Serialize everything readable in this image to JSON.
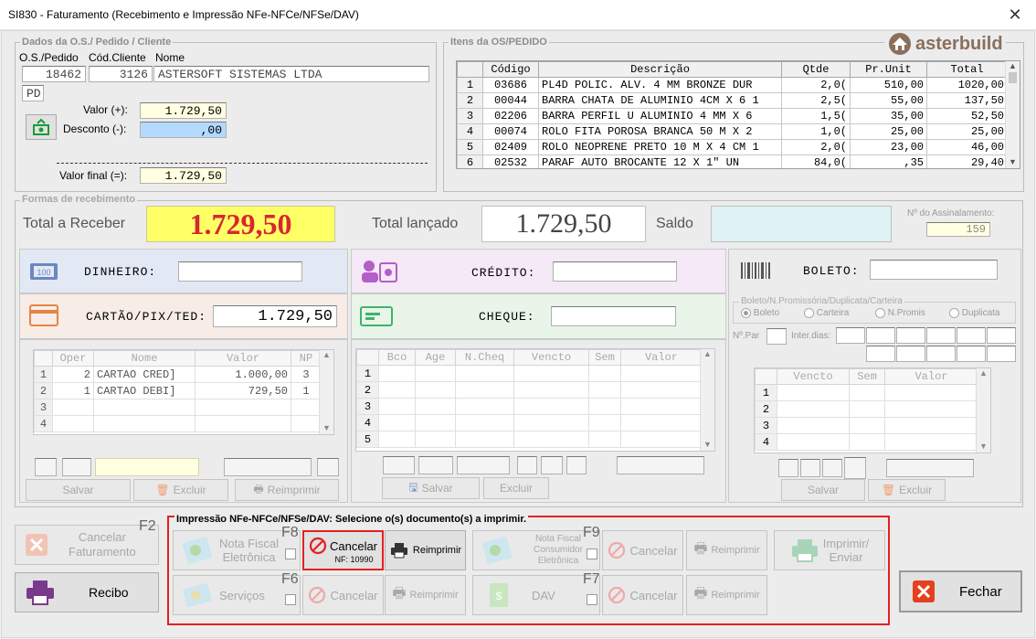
{
  "window": {
    "title": "SI830 - Faturamento (Recebimento e Impressão NFe-NFCe/NFSe/DAV)",
    "close": "✕"
  },
  "logo": {
    "text": "asterbuild"
  },
  "dados": {
    "group_label": "Dados da O.S./ Pedido / Cliente",
    "col_os": "O.S./Pedido",
    "col_cli": "Cód.Cliente",
    "col_nome": "Nome",
    "os": "18462",
    "cliente": "3126",
    "nome": "ASTERSOFT SISTEMAS LTDA",
    "tipo": "PD",
    "valor_label": "Valor (+):",
    "valor": "1.729,50",
    "desconto_label": "Desconto (-):",
    "desconto": ",00",
    "final_label": "Valor final (=):",
    "final": "1.729,50"
  },
  "itens": {
    "group_label": "Itens da OS/PEDIDO",
    "headers": [
      "",
      "Código",
      "Descrição",
      "Qtde",
      "Pr.Unit",
      "Total"
    ],
    "rows": [
      [
        "1",
        "03686",
        "PL4D POLIC. ALV. 4 MM BRONZE DUR",
        "2,0(",
        "510,00",
        "1020,00"
      ],
      [
        "2",
        "00044",
        "BARRA CHATA DE ALUMINIO 4CM X 6 1",
        "2,5(",
        "55,00",
        "137,50"
      ],
      [
        "3",
        "02206",
        "BARRA PERFIL U ALUMINIO 4 MM X 6",
        "1,5(",
        "35,00",
        "52,50"
      ],
      [
        "4",
        "00074",
        "ROLO FITA POROSA BRANCA 50 M X 2",
        "1,0(",
        "25,00",
        "25,00"
      ],
      [
        "5",
        "02409",
        "ROLO NEOPRENE PRETO 10 M X 4 CM 1",
        "2,0(",
        "23,00",
        "46,00"
      ],
      [
        "6",
        "02532",
        "PARAF AUTO BROCANTE  12 X 1\"  UN",
        "84,0(",
        ",35",
        "29,40"
      ]
    ]
  },
  "formas": {
    "group_label": "Formas de recebimento",
    "total_receber_label": "Total a Receber",
    "total_receber": "1.729,50",
    "total_lancado_label": "Total lançado",
    "total_lancado": "1.729,50",
    "saldo_label": "Saldo",
    "saldo": "",
    "assinal_label": "Nº do Assinalamento:",
    "assinal": "159"
  },
  "dinheiro": {
    "label": "DINHEIRO:",
    "value": ""
  },
  "cartao": {
    "label": "CARTÃO/PIX/TED:",
    "value": "1.729,50",
    "headers": [
      "",
      "Oper",
      "Nome",
      "Valor",
      "NP"
    ],
    "rows": [
      [
        "1",
        "2",
        "CARTAO CRED]",
        "1.000,00",
        "3"
      ],
      [
        "2",
        "1",
        "CARTAO DEBI]",
        "729,50",
        "1"
      ],
      [
        "3",
        "",
        "",
        "",
        ""
      ],
      [
        "4",
        "",
        "",
        "",
        ""
      ]
    ],
    "salvar": "Salvar",
    "excluir": "Excluir",
    "reimprimir": "Reimprimir"
  },
  "credito": {
    "label": "CRÉDITO:",
    "value": ""
  },
  "cheque": {
    "label": "CHEQUE:",
    "value": "",
    "headers": [
      "",
      "Bco",
      "Age",
      "N.Cheq",
      "Vencto",
      "Sem",
      "Valor"
    ],
    "rows": [
      [
        "1"
      ],
      [
        "2"
      ],
      [
        "3"
      ],
      [
        "4"
      ],
      [
        "5"
      ]
    ],
    "salvar": "Salvar",
    "excluir": "Excluir"
  },
  "boleto": {
    "label": "BOLETO:",
    "value": "",
    "sub_label": "Boleto/N.Promissória/Duplicata/Carteira",
    "options": [
      "Boleto",
      "Carteira",
      "N.Promis",
      "Duplicata"
    ],
    "npar_label": "Nº.Par",
    "inter_label": "Inter.dias:",
    "headers": [
      "",
      "Vencto",
      "Sem",
      "Valor"
    ],
    "rows": [
      [
        "1"
      ],
      [
        "2"
      ],
      [
        "3"
      ],
      [
        "4"
      ]
    ],
    "salvar": "Salvar",
    "excluir": "Excluir"
  },
  "bottom": {
    "cancelar_fat": "Cancelar\nFaturamento",
    "f2": "F2",
    "recibo": "Recibo",
    "impressao_label": "Impressão NFe-NFCe/NFSe/DAV: Selecione o(s) documento(s) a imprimir.",
    "nfe": "Nota Fiscal\nEletrônica",
    "f8": "F8",
    "cancelar": "Cancelar",
    "nf_num": "NF:  10990",
    "reimprimir": "Reimprimir",
    "nfce": "Nota Fiscal\nConsumidor\nEletrônica",
    "f9": "F9",
    "imprimir_enviar": "Imprimir/\nEnviar",
    "servicos": "Serviços",
    "f6": "F6",
    "dav": "DAV",
    "f7": "F7",
    "fechar": "Fechar"
  },
  "colors": {
    "accent_red": "#e41f1f",
    "yellow": "#ffff66",
    "total_red": "#d9262f"
  }
}
